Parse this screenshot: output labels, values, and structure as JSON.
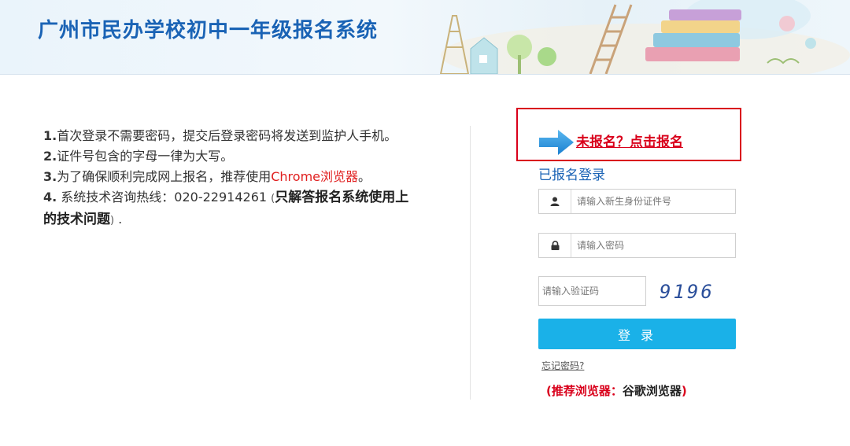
{
  "header": {
    "title": "广州市民办学校初中一年级报名系统"
  },
  "notes": {
    "n1": "1.",
    "t1": "首次登录不需要密码，提交后登录密码将发送到监护人手机。",
    "n2": "2.",
    "t2": "证件号包含的字母一律为大写。",
    "n3": "3.",
    "t3a": "为了确保顺利完成网上报名，推荐使用",
    "t3b": "Chrome浏览器",
    "t3c": "。",
    "n4": "4.",
    "t4a": " 系统技术咨询热线：020-22914261 ",
    "t4b": "(",
    "t4c": "只解答报名系统使用上的技术问题",
    "t4d": ")",
    "t4e": " ."
  },
  "register": {
    "link": "未报名？点击报名"
  },
  "login": {
    "title": "已报名登录",
    "id_placeholder": "请输入新生身份证件号",
    "password_placeholder": "请输入密码",
    "captcha_placeholder": "请输入验证码",
    "captcha_code": "9196",
    "button": "登 录",
    "forgot": "忘记密码?",
    "tip_open": "(",
    "tip_label": "推荐浏览器：",
    "tip_browser": "谷歌浏览器",
    "tip_close": ")"
  },
  "icons": {
    "user": "user-icon",
    "lock": "lock-icon",
    "arrow": "arrow-right-icon"
  },
  "colors": {
    "brand_blue": "#1a63b5",
    "button_blue": "#1ab1e8",
    "accent_red": "#d9001b"
  }
}
